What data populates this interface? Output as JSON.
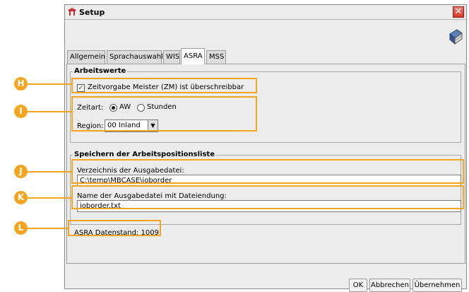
{
  "window": {
    "title": "Setup",
    "close_symbol": "✕",
    "icons": [
      "setup-title-icon",
      "book-icon",
      "close-icon"
    ]
  },
  "tabs": [
    {
      "label": "Allgemein",
      "active": false
    },
    {
      "label": "Sprachauswahl",
      "active": false
    },
    {
      "label": "WIS",
      "active": false
    },
    {
      "label": "ASRA",
      "active": true
    },
    {
      "label": "MSS",
      "active": false
    }
  ],
  "arbeitswerte": {
    "title": "Arbeitswerte",
    "checkbox_label": "Zeitvorgabe Meister (ZM) ist überschreibbar",
    "checkbox_checked": true,
    "zeitart_label": "Zeitart:",
    "zeitart_options": [
      "AW",
      "Stunden"
    ],
    "zeitart_selected": "AW",
    "region_label": "Region:",
    "region_value": "00 Inland"
  },
  "speichern": {
    "title": "Speichern der Arbeitspositionsliste",
    "dir_label": "Verzeichnis der Ausgabedatei:",
    "dir_value": "C:\\temp\\MBCASE\\joborder",
    "file_label": "Name der Ausgabedatei mit Dateiendung:",
    "file_value": "joborder.txt"
  },
  "datenstand": "ASRA Datenstand: 1009",
  "buttons": {
    "ok": "OK",
    "cancel": "Abbrechen",
    "apply": "Übernehmen"
  },
  "annotations": {
    "colour": "#f3a51f",
    "badges": [
      "H",
      "I",
      "J",
      "K",
      "L"
    ]
  }
}
